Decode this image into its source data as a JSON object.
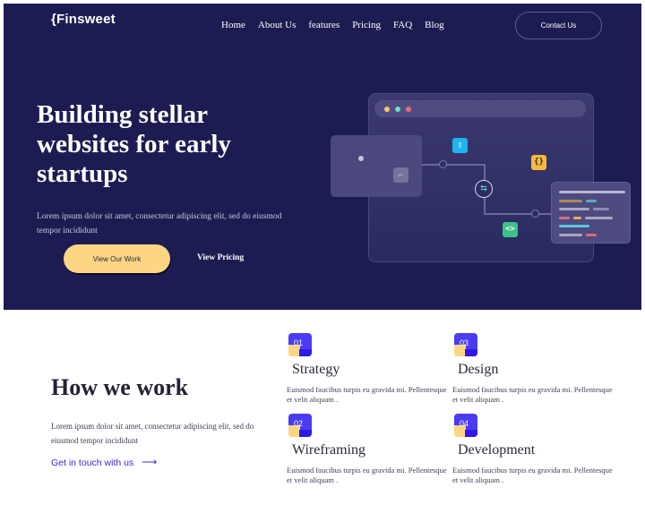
{
  "brand": {
    "logo": "{Finsweet"
  },
  "nav": {
    "items": [
      "Home",
      "About Us",
      "features",
      "Pricing",
      "FAQ",
      "Blog"
    ],
    "contact_label": "Contact Us"
  },
  "hero": {
    "title": "Building stellar websites for early startups",
    "text": "Lorem ipsum dolor sit amet, consectetur adipiscing elit, sed do eiusmod tempor incididunt",
    "primary_label": "View Our Work",
    "secondary_label": "View Pricing"
  },
  "illustration": {
    "window_dots": [
      "#f7c86a",
      "#6fe0c9",
      "#e86a88"
    ],
    "chips": [
      {
        "icon": "file-icon",
        "glyph": "▯",
        "color": "#1fb4f0"
      },
      {
        "icon": "braces-icon",
        "glyph": "{}",
        "color": "#f6b93b"
      },
      {
        "icon": "code-icon",
        "glyph": "<>",
        "color": "#3fc08a"
      }
    ],
    "hub_glyph": "⇆",
    "panel_glyph": "⌐"
  },
  "how": {
    "title": "How we work",
    "text": "Lorem ipsum dolor sit amet, consectetur adipiscing elit, sed do eiusmod tempor incididunt",
    "link_label": "Get in touch with us",
    "link_arrow": "⟶",
    "steps": [
      {
        "num": "01",
        "title": "Strategy",
        "text": "Euismod faucibus turpis eu gravida mi. Pellentesque et velit aliquam ."
      },
      {
        "num": "02",
        "title": "Wireframing",
        "text": "Euismod faucibus turpis eu gravida mi. Pellentesque et velit aliquam ."
      },
      {
        "num": "03",
        "title": "Design",
        "text": "Euismod faucibus turpis eu gravida mi. Pellentesque et velit aliquam ."
      },
      {
        "num": "04",
        "title": "Development",
        "text": "Euismod faucibus turpis eu gravida mi. Pellentesque et velit aliquam ."
      }
    ]
  },
  "colors": {
    "hero_bg": "#1d1c52",
    "accent_yellow": "#fdd683",
    "accent_blue": "#4b3cf0",
    "link_blue": "#3b2bd6"
  }
}
